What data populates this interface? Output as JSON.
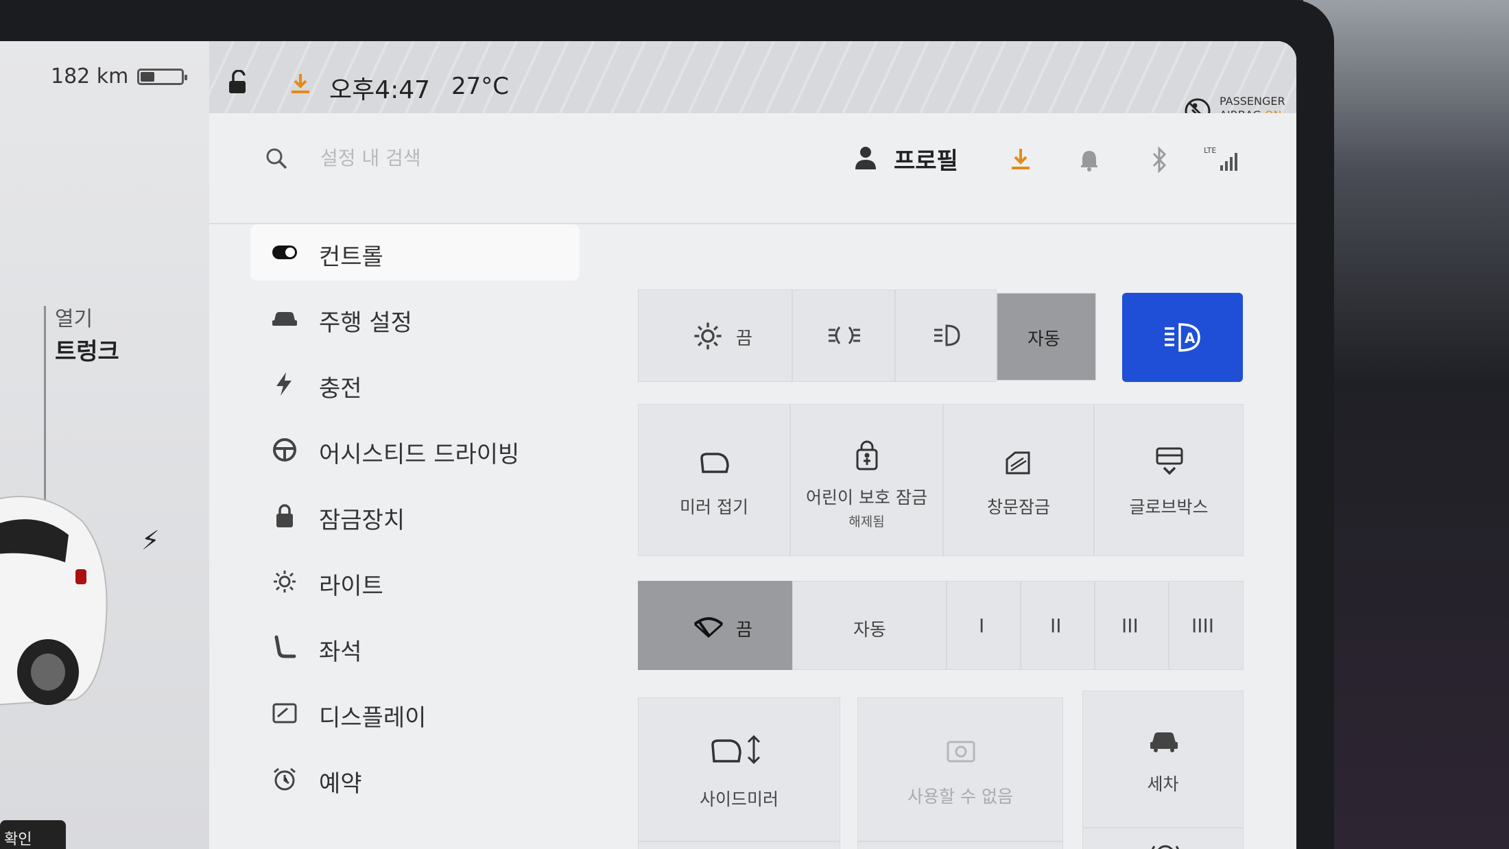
{
  "status": {
    "range": "182 km",
    "battery_level": 0.35,
    "time": "오후4:47",
    "temperature": "27°C",
    "airbag_line1": "PASSENGER",
    "airbag_line2": "AIRBAG",
    "airbag_state": "ON"
  },
  "car_panel": {
    "open_label": "열기",
    "trunk_label": "트렁크",
    "bottom_badge": "확인"
  },
  "header": {
    "search_placeholder": "설정 내 검색",
    "profile_label": "프로필",
    "signal_label": "LTE"
  },
  "sidebar": {
    "items": [
      {
        "label": "컨트롤",
        "icon": "toggle-icon",
        "active": true
      },
      {
        "label": "주행 설정",
        "icon": "car-icon"
      },
      {
        "label": "충전",
        "icon": "bolt-icon"
      },
      {
        "label": "어시스티드 드라이빙",
        "icon": "steering-wheel-icon"
      },
      {
        "label": "잠금장치",
        "icon": "lock-icon"
      },
      {
        "label": "라이트",
        "icon": "sun-icon"
      },
      {
        "label": "좌석",
        "icon": "seat-icon"
      },
      {
        "label": "디스플레이",
        "icon": "display-icon"
      },
      {
        "label": "예약",
        "icon": "alarm-clock-icon"
      }
    ]
  },
  "lights": {
    "off_label": "끔",
    "auto_label": "자동"
  },
  "controls": {
    "mirror_fold": "미러 접기",
    "child_lock": "어린이 보호 잠금",
    "child_lock_state": "해제됨",
    "window_lock": "창문잠금",
    "glovebox": "글로브박스"
  },
  "wipers": {
    "off_label": "끔",
    "auto_label": "자동",
    "speeds": [
      "I",
      "II",
      "III",
      "IIII"
    ]
  },
  "bottom_cards": {
    "side_mirror": "사이드미러",
    "unavailable": "사용할 수 없음",
    "car_wash": "세차"
  }
}
